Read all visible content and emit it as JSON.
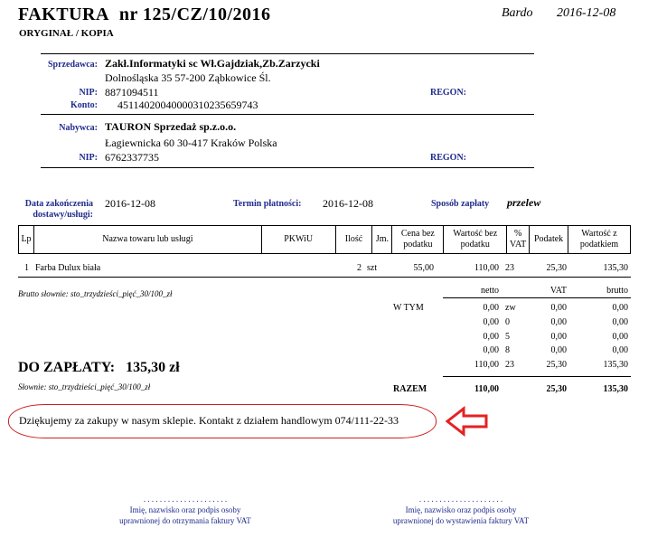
{
  "header": {
    "title_word": "FAKTURA",
    "title_number": "nr  125/CZ/10/2016",
    "subtitle": "ORYGINAŁ  /  KOPIA",
    "place": "Bardo",
    "date": "2016-12-08"
  },
  "seller": {
    "label": "Sprzedawca:",
    "name": "Zakł.Informatyki sc Wł.Gajdziak,Zb.Zarzycki",
    "address": "Dolnośląska 35    57-200  Ząbkowice Śl.",
    "nip_label": "NIP:",
    "nip": "8871094511",
    "regon_label": "REGON:",
    "konto_label": "Konto:",
    "konto": "45114020040000310235659743"
  },
  "buyer": {
    "label": "Nabywca:",
    "name": "TAURON Sprzedaż sp.z.o.o.",
    "address": "Łagiewnicka 60    30-417  Kraków     Polska",
    "nip_label": "NIP:",
    "nip": "6762337735",
    "regon_label": "REGON:"
  },
  "terms": {
    "delivery_label_1": "Data zakończenia",
    "delivery_label_2": "dostawy/usługi:",
    "delivery_date": "2016-12-08",
    "payment_term_label": "Termin płatności:",
    "payment_term": "2016-12-08",
    "payment_method_label": "Sposób zapłaty",
    "payment_method": "przelew"
  },
  "items_table": {
    "headers": [
      "Lp",
      "Nazwa towaru lub usługi",
      "PKWiU",
      "Ilość",
      "Jm.",
      "Cena bez podatku",
      "Wartość bez podatku",
      "% VAT",
      "Podatek",
      "Wartość z podatkiem"
    ],
    "rows": [
      {
        "lp": "1",
        "name": "Farba Dulux biała",
        "pkwiu": "",
        "qty": "2",
        "unit": "szt",
        "price": "55,00",
        "net": "110,00",
        "vat": "23",
        "tax": "25,30",
        "gross": "135,30"
      }
    ]
  },
  "summary": {
    "brutto_words": "Brutto słownie: sto_trzydzieści_pięć_30/100_zł",
    "col_headers": [
      "netto",
      "VAT",
      "brutto"
    ],
    "w_tym_label": "W TYM",
    "rows": [
      {
        "netto": "0,00",
        "rate": "zw",
        "vat": "0,00",
        "brutto": "0,00"
      },
      {
        "netto": "0,00",
        "rate": "0",
        "vat": "0,00",
        "brutto": "0,00"
      },
      {
        "netto": "0,00",
        "rate": "5",
        "vat": "0,00",
        "brutto": "0,00"
      },
      {
        "netto": "0,00",
        "rate": "8",
        "vat": "0,00",
        "brutto": "0,00"
      },
      {
        "netto": "110,00",
        "rate": "23",
        "vat": "25,30",
        "brutto": "135,30"
      }
    ],
    "razem_label": "RAZEM",
    "razem_netto": "110,00",
    "razem_vat": "25,30",
    "razem_brutto": "135,30",
    "do_zaplaty_label": "DO ZAPŁATY:",
    "do_zaplaty_value": "135,30 zł",
    "slownie": "Słownie:  sto_trzydzieści_pięć_30/100_zł"
  },
  "thanks": {
    "text": "Dziękujemy za zakupy w nasym sklepie. Kontakt z działem handlowym 074/111-22-33",
    "arrow_color": "#e52222"
  },
  "signatures": {
    "dots": ". . . . . . . . . . . . . . . . . . . . .",
    "left_1": "Imię, nazwisko oraz podpis osoby",
    "left_2": "uprawnionej do otrzymania faktury VAT",
    "right_1": "Imię, nazwisko oraz podpis osoby",
    "right_2": "uprawnionej do wystawienia faktury VAT"
  }
}
